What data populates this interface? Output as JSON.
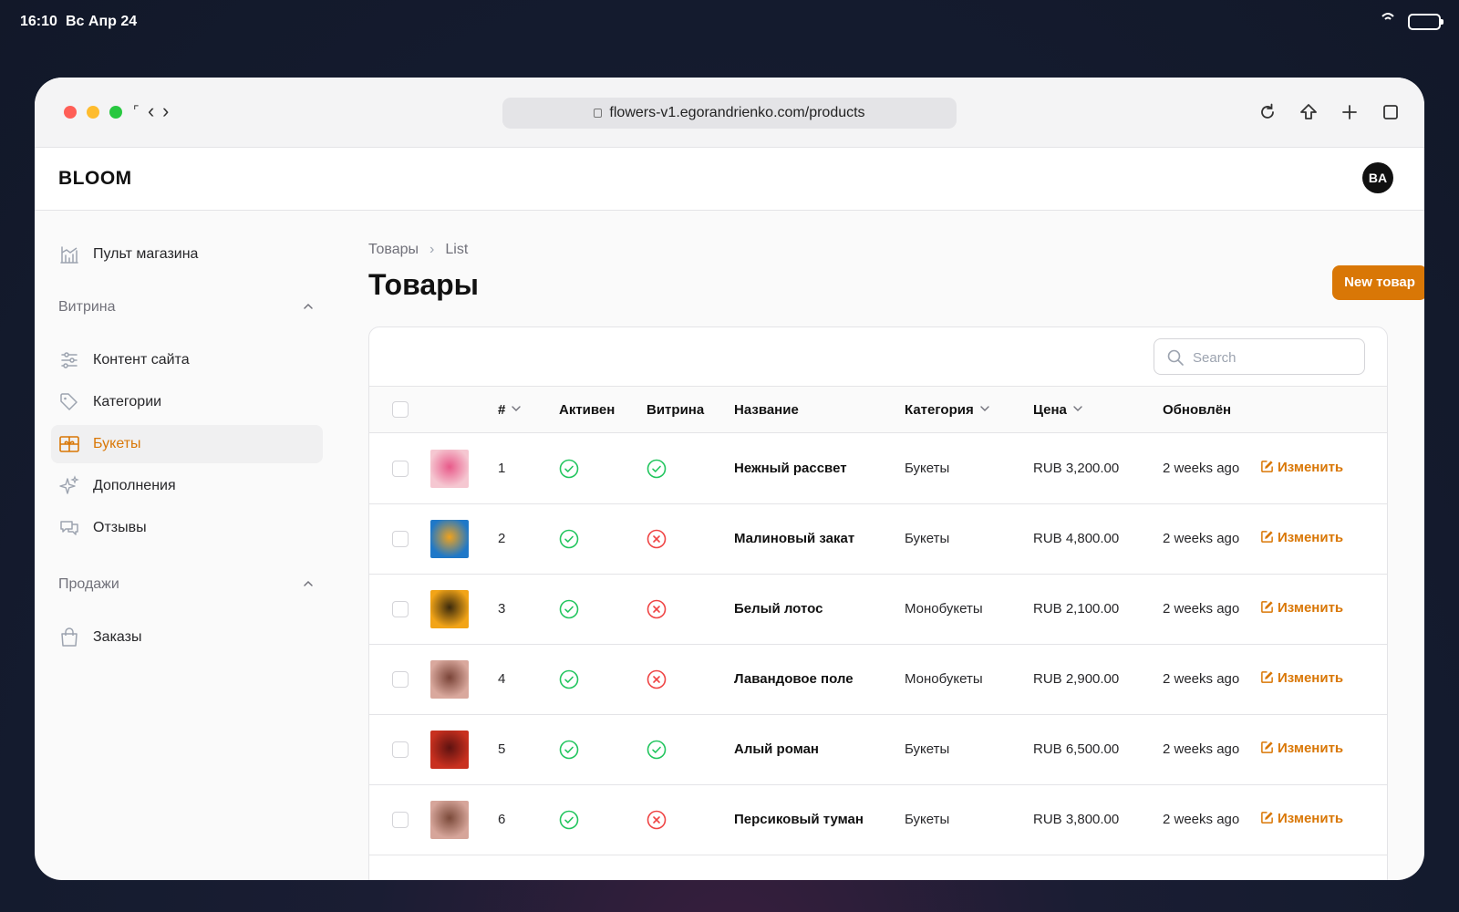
{
  "status_bar": {
    "time": "16:10",
    "date": "Вс Апр 24"
  },
  "browser": {
    "url": "flowers-v1.egorandrienko.com/products"
  },
  "app": {
    "logo": "BLOOM",
    "avatar_initials": "BA",
    "accent_color": "#d97706"
  },
  "sidebar": {
    "dashboard": {
      "label": "Пульт магазина",
      "icon": "shop-chart-icon"
    },
    "groups": [
      {
        "label": "Витрина",
        "items": [
          {
            "label": "Контент сайта",
            "icon": "sliders-icon",
            "active": false
          },
          {
            "label": "Категории",
            "icon": "tag-icon",
            "active": false
          },
          {
            "label": "Букеты",
            "icon": "gift-icon",
            "active": true
          },
          {
            "label": "Дополнения",
            "icon": "sparkles-icon",
            "active": false
          },
          {
            "label": "Отзывы",
            "icon": "chat-bubbles-icon",
            "active": false
          }
        ]
      },
      {
        "label": "Продажи",
        "items": [
          {
            "label": "Заказы",
            "icon": "shopping-bag-icon",
            "active": false
          }
        ]
      }
    ]
  },
  "main": {
    "breadcrumb": [
      "Товары",
      "List"
    ],
    "title": "Товары",
    "new_button": "New товар",
    "search_placeholder": "Search",
    "columns": {
      "num": "#",
      "active": "Активен",
      "showcase": "Витрина",
      "name": "Название",
      "category": "Категория",
      "price": "Цена",
      "updated": "Обновлён"
    },
    "edit_label": "Изменить",
    "rows": [
      {
        "num": "1",
        "active": true,
        "showcase": true,
        "name": "Нежный рассвет",
        "category": "Букеты",
        "price": "RUB 3,200.00",
        "updated": "2 weeks ago",
        "thumb_colors": [
          "#f5c7d1",
          "#e85a8a"
        ]
      },
      {
        "num": "2",
        "active": true,
        "showcase": false,
        "name": "Малиновый закат",
        "category": "Букеты",
        "price": "RUB 4,800.00",
        "updated": "2 weeks ago",
        "thumb_colors": [
          "#1f78c8",
          "#f0a21c"
        ]
      },
      {
        "num": "3",
        "active": true,
        "showcase": false,
        "name": "Белый лотос",
        "category": "Монобукеты",
        "price": "RUB 2,100.00",
        "updated": "2 weeks ago",
        "thumb_colors": [
          "#f2a417",
          "#3b2a0c"
        ]
      },
      {
        "num": "4",
        "active": true,
        "showcase": false,
        "name": "Лавандовое поле",
        "category": "Монобукеты",
        "price": "RUB 2,900.00",
        "updated": "2 weeks ago",
        "thumb_colors": [
          "#d9a89d",
          "#7a4438"
        ]
      },
      {
        "num": "5",
        "active": true,
        "showcase": true,
        "name": "Алый роман",
        "category": "Букеты",
        "price": "RUB 6,500.00",
        "updated": "2 weeks ago",
        "thumb_colors": [
          "#c8301f",
          "#5e1210"
        ]
      },
      {
        "num": "6",
        "active": true,
        "showcase": false,
        "name": "Персиковый туман",
        "category": "Букеты",
        "price": "RUB 3,800.00",
        "updated": "2 weeks ago",
        "thumb_colors": [
          "#d6a59a",
          "#7b4a3a"
        ]
      }
    ]
  }
}
